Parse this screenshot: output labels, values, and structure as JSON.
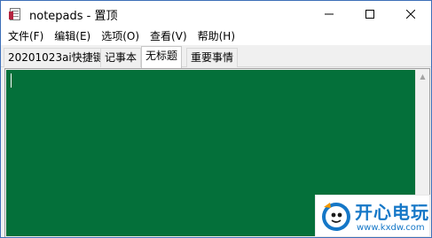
{
  "window": {
    "title": "notepads - 置顶",
    "controls": {
      "minimize_icon": "minimize-icon",
      "maximize_icon": "maximize-icon",
      "close_icon": "close-icon"
    }
  },
  "menu": [
    {
      "label": "文件(F)"
    },
    {
      "label": "编辑(E)"
    },
    {
      "label": "选项(O)"
    },
    {
      "label": "查看(V)"
    },
    {
      "label": "帮助(H)"
    }
  ],
  "tabs": [
    {
      "label": "20201023ai快捷键",
      "active": false
    },
    {
      "label": "记事本",
      "active": false
    },
    {
      "label": "无标题",
      "active": true
    },
    {
      "label": "重要事情",
      "active": false
    }
  ],
  "editor": {
    "content": "",
    "background": "#04703a"
  },
  "watermark": {
    "main": "开心电玩",
    "url": "www.kxdw.com"
  },
  "colors": {
    "accent": "#1577c7",
    "editor_bg": "#04703a",
    "close_hover": "#e81123"
  }
}
